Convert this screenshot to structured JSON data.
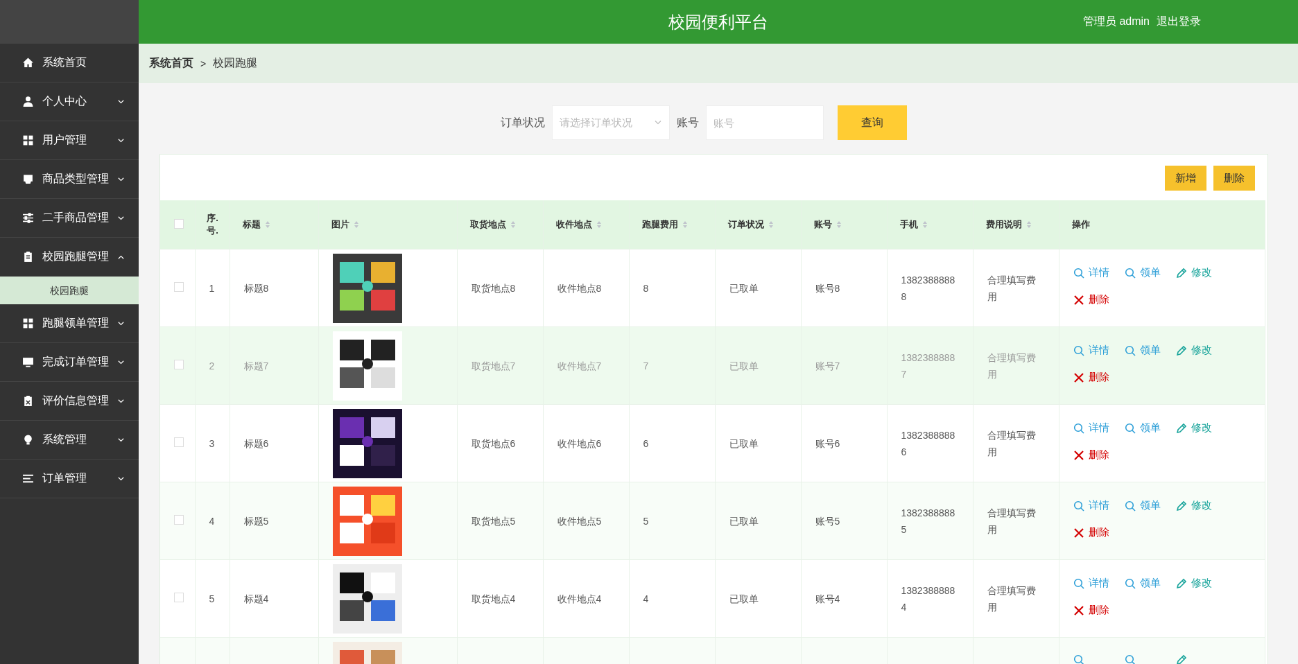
{
  "header": {
    "title": "校园便利平台",
    "user": "管理员 admin",
    "logout": "退出登录"
  },
  "sidebar": {
    "items": [
      {
        "label": "系统首页",
        "kind": "link"
      },
      {
        "label": "个人中心",
        "kind": "menu",
        "expanded": false
      },
      {
        "label": "用户管理",
        "kind": "menu",
        "expanded": false
      },
      {
        "label": "商品类型管理",
        "kind": "menu",
        "expanded": false
      },
      {
        "label": "二手商品管理",
        "kind": "menu",
        "expanded": false
      },
      {
        "label": "校园跑腿管理",
        "kind": "menu",
        "expanded": true,
        "children": [
          {
            "label": "校园跑腿",
            "selected": true
          }
        ]
      },
      {
        "label": "跑腿领单管理",
        "kind": "menu",
        "expanded": false
      },
      {
        "label": "完成订单管理",
        "kind": "menu",
        "expanded": false
      },
      {
        "label": "评价信息管理",
        "kind": "menu",
        "expanded": false
      },
      {
        "label": "系统管理",
        "kind": "menu",
        "expanded": false
      },
      {
        "label": "订单管理",
        "kind": "menu",
        "expanded": false
      }
    ]
  },
  "breadcrumb": [
    "系统首页",
    "校园跑腿"
  ],
  "breadcrumb_separator": ">",
  "filters": [
    {
      "label": "订单状况",
      "kind": "select",
      "placeholder": "请选择订单状况"
    },
    {
      "label": "账号",
      "kind": "input",
      "placeholder": "账号"
    }
  ],
  "search_button": "查询",
  "toolbar_buttons": [
    "新增",
    "删除"
  ],
  "table": {
    "all_checked": false,
    "columns": [
      {
        "label": "序.号.",
        "sortable": false
      },
      {
        "label": "标题",
        "sortable": true
      },
      {
        "label": "图片",
        "sortable": true
      },
      {
        "label": "取货地点",
        "sortable": true
      },
      {
        "label": "收件地点",
        "sortable": true
      },
      {
        "label": "跑腿费用",
        "sortable": true
      },
      {
        "label": "订单状况",
        "sortable": true
      },
      {
        "label": "账号",
        "sortable": true
      },
      {
        "label": "手机",
        "sortable": true
      },
      {
        "label": "费用说明",
        "sortable": true
      },
      {
        "label": "操作",
        "sortable": false
      }
    ],
    "rows": [
      {
        "kind": "full",
        "checked": false,
        "highlighted": false,
        "cells": [
          "1",
          "标题8",
          "",
          "取货地点8",
          "收件地点8",
          "8",
          "已取单",
          "账号8",
          "13823888888",
          "合理填写费用"
        ],
        "actions": [
          {
            "kind": "view",
            "label": "详情"
          },
          {
            "kind": "take",
            "label": "领单"
          },
          {
            "kind": "edit",
            "label": "修改"
          },
          {
            "kind": "delete",
            "label": "删除"
          }
        ]
      },
      {
        "kind": "full",
        "checked": false,
        "highlighted": true,
        "cells": [
          "2",
          "标题7",
          "",
          "取货地点7",
          "收件地点7",
          "7",
          "已取单",
          "账号7",
          "13823888887",
          "合理填写费用"
        ],
        "actions": [
          {
            "kind": "view",
            "label": "详情"
          },
          {
            "kind": "take",
            "label": "领单"
          },
          {
            "kind": "edit",
            "label": "修改"
          },
          {
            "kind": "delete",
            "label": "删除"
          }
        ]
      },
      {
        "kind": "full",
        "checked": false,
        "highlighted": false,
        "cells": [
          "3",
          "标题6",
          "",
          "取货地点6",
          "收件地点6",
          "6",
          "已取单",
          "账号6",
          "13823888886",
          "合理填写费用"
        ],
        "actions": [
          {
            "kind": "view",
            "label": "详情"
          },
          {
            "kind": "take",
            "label": "领单"
          },
          {
            "kind": "edit",
            "label": "修改"
          },
          {
            "kind": "delete",
            "label": "删除"
          }
        ]
      },
      {
        "kind": "full",
        "checked": false,
        "highlighted": false,
        "cells": [
          "4",
          "标题5",
          "",
          "取货地点5",
          "收件地点5",
          "5",
          "已取单",
          "账号5",
          "13823888885",
          "合理填写费用"
        ],
        "actions": [
          {
            "kind": "view",
            "label": "详情"
          },
          {
            "kind": "take",
            "label": "领单"
          },
          {
            "kind": "edit",
            "label": "修改"
          },
          {
            "kind": "delete",
            "label": "删除"
          }
        ]
      },
      {
        "kind": "full",
        "checked": false,
        "highlighted": false,
        "cells": [
          "5",
          "标题4",
          "",
          "取货地点4",
          "收件地点4",
          "4",
          "已取单",
          "账号4",
          "13823888884",
          "合理填写费用"
        ],
        "actions": [
          {
            "kind": "view",
            "label": "详情"
          },
          {
            "kind": "take",
            "label": "领单"
          },
          {
            "kind": "edit",
            "label": "修改"
          },
          {
            "kind": "delete",
            "label": "删除"
          }
        ]
      },
      {
        "kind": "partial",
        "actions": [
          {
            "kind": "view"
          },
          {
            "kind": "take"
          },
          {
            "kind": "edit"
          }
        ]
      }
    ]
  }
}
